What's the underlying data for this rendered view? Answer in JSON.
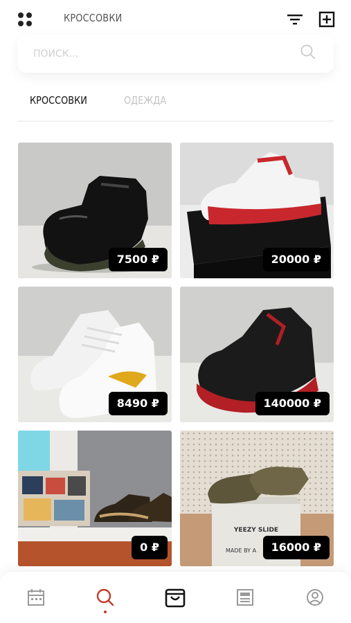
{
  "header": {
    "title": "КРОССОВКИ",
    "menu_icon": "grid-dots-icon",
    "filter_icon": "filter-icon",
    "add_icon": "add-square-icon"
  },
  "search": {
    "placeholder": "ПОИСК...",
    "icon": "search-icon"
  },
  "tabs": [
    {
      "label": "КРОССОВКИ",
      "active": true
    },
    {
      "label": "ОДЕЖДА",
      "active": false
    }
  ],
  "products": [
    {
      "price": "7500 ₽",
      "image": "black patent high-top sneaker"
    },
    {
      "price": "20000 ₽",
      "image": "white and red sneaker on black box"
    },
    {
      "price": "8490 ₽",
      "image": "white high-top sneaker with yellow swoosh"
    },
    {
      "price": "140000 ₽",
      "image": "black and red sneaker"
    },
    {
      "price": "0 ₽",
      "image": "sneakers next to shoe box on shelf"
    },
    {
      "price": "16000 ₽",
      "image": "olive slide on box labeled YEEZY SLIDE"
    }
  ],
  "photo_text": {
    "box_label_1": "YEEZY SLIDE",
    "box_label_2": "MADE BY A"
  },
  "bottom_nav": [
    {
      "icon": "calendar-icon",
      "active": false
    },
    {
      "icon": "search-icon",
      "active": true
    },
    {
      "icon": "shopping-bag-icon",
      "active": false
    },
    {
      "icon": "news-icon",
      "active": false
    },
    {
      "icon": "profile-icon",
      "active": false
    }
  ],
  "colors": {
    "accent": "#c0392b",
    "price_badge": "#000000",
    "inactive_tab": "#c4c4c4"
  }
}
